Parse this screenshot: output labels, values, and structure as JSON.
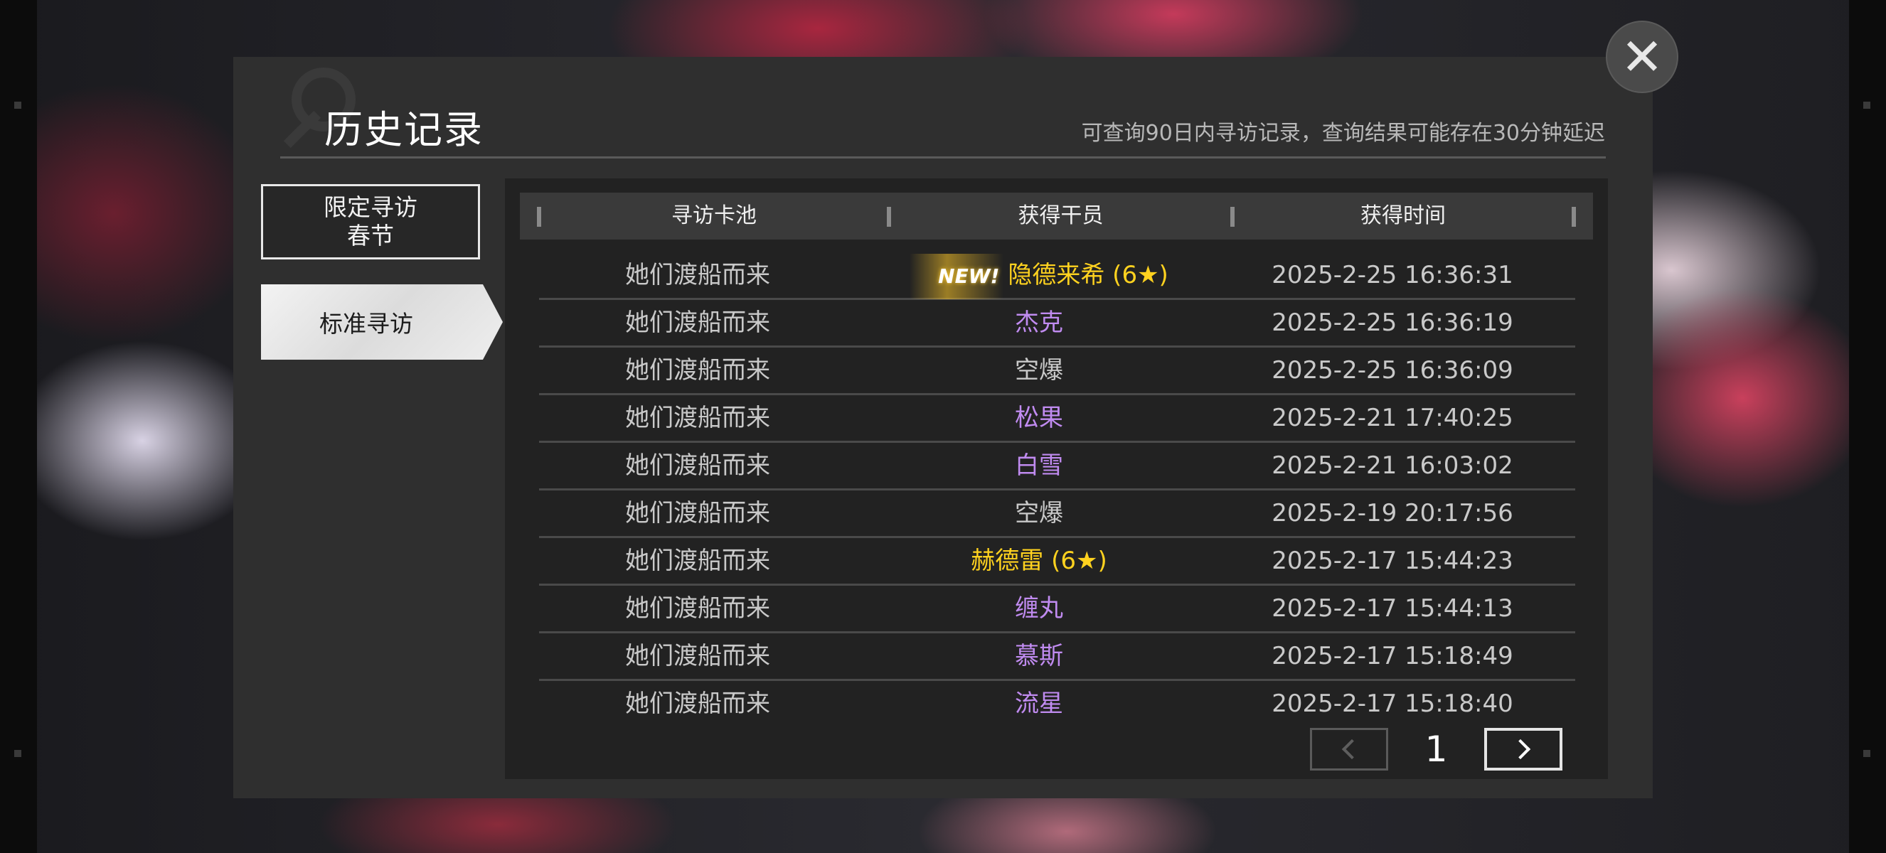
{
  "dialog": {
    "title": "历史记录",
    "subtitle": "可查询90日内寻访记录，查询结果可能存在30分钟延迟",
    "close_icon": "✕"
  },
  "tabs": [
    {
      "label": "限定寻访\n春节",
      "active": false
    },
    {
      "label": "标准寻访",
      "active": true
    }
  ],
  "table": {
    "headers": [
      "寻访卡池",
      "获得干员",
      "获得时间"
    ],
    "new_badge": "NEW!",
    "rows": [
      {
        "pool": "她们渡船而来",
        "operator": "隐德来希 (6★)",
        "time": "2025-2-25 16:36:31",
        "rarity_color": "#ffd21f",
        "is_new": true
      },
      {
        "pool": "她们渡船而来",
        "operator": "杰克",
        "time": "2025-2-25 16:36:19",
        "rarity_color": "#c08bf0",
        "is_new": false
      },
      {
        "pool": "她们渡船而来",
        "operator": "空爆",
        "time": "2025-2-25 16:36:09",
        "rarity_color": "#c9c9c9",
        "is_new": false
      },
      {
        "pool": "她们渡船而来",
        "operator": "松果",
        "time": "2025-2-21 17:40:25",
        "rarity_color": "#c08bf0",
        "is_new": false
      },
      {
        "pool": "她们渡船而来",
        "operator": "白雪",
        "time": "2025-2-21 16:03:02",
        "rarity_color": "#c08bf0",
        "is_new": false
      },
      {
        "pool": "她们渡船而来",
        "operator": "空爆",
        "time": "2025-2-19 20:17:56",
        "rarity_color": "#c9c9c9",
        "is_new": false
      },
      {
        "pool": "她们渡船而来",
        "operator": "赫德雷 (6★)",
        "time": "2025-2-17 15:44:23",
        "rarity_color": "#ffd21f",
        "is_new": false
      },
      {
        "pool": "她们渡船而来",
        "operator": "缠丸",
        "time": "2025-2-17 15:44:13",
        "rarity_color": "#c08bf0",
        "is_new": false
      },
      {
        "pool": "她们渡船而来",
        "operator": "慕斯",
        "time": "2025-2-17 15:18:49",
        "rarity_color": "#c08bf0",
        "is_new": false
      },
      {
        "pool": "她们渡船而来",
        "operator": "流星",
        "time": "2025-2-17 15:18:40",
        "rarity_color": "#c08bf0",
        "is_new": false
      }
    ]
  },
  "pagination": {
    "current_page": "1",
    "prev_enabled": false,
    "next_enabled": true
  },
  "icons": {
    "prev": "chevron-left-icon",
    "next": "chevron-right-icon",
    "close": "close-icon"
  }
}
